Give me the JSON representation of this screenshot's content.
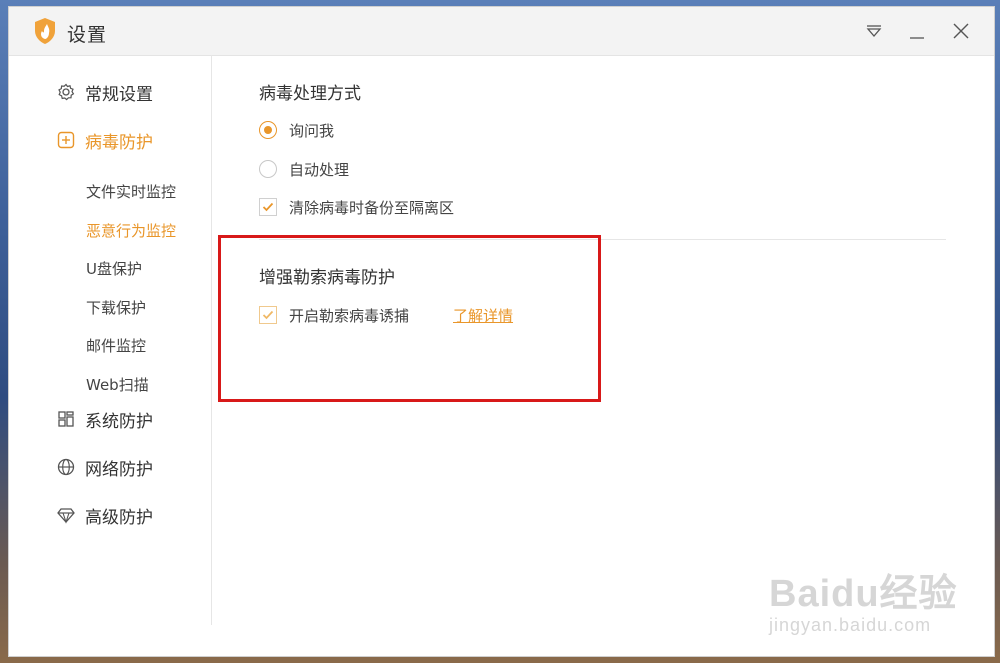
{
  "window": {
    "title": "设置",
    "logo_icon": "flame-shield-icon",
    "controls": [
      "dropdown-icon",
      "minimize-icon",
      "close-icon"
    ]
  },
  "sidebar": {
    "items": [
      {
        "label": "常规设置",
        "icon": "gear-icon",
        "active": false
      },
      {
        "label": "病毒防护",
        "icon": "plus-square-icon",
        "active": true
      },
      {
        "label": "系统防护",
        "icon": "grid-icon",
        "active": false
      },
      {
        "label": "网络防护",
        "icon": "globe-icon",
        "active": false
      },
      {
        "label": "高级防护",
        "icon": "diamond-icon",
        "active": false
      }
    ],
    "subitems": [
      {
        "label": "文件实时监控",
        "active": false
      },
      {
        "label": "恶意行为监控",
        "active": true
      },
      {
        "label": "U盘保护",
        "active": false
      },
      {
        "label": "下载保护",
        "active": false
      },
      {
        "label": "邮件监控",
        "active": false
      },
      {
        "label": "Web扫描",
        "active": false
      }
    ]
  },
  "virus_handling": {
    "title": "病毒处理方式",
    "options": [
      {
        "label": "询问我",
        "type": "radio",
        "checked": true
      },
      {
        "label": "自动处理",
        "type": "radio",
        "checked": false
      },
      {
        "label": "清除病毒时备份至隔离区",
        "type": "checkbox",
        "checked": true
      }
    ]
  },
  "ransomware": {
    "title": "增强勒索病毒防护",
    "option_label": "开启勒索病毒诱捕",
    "option_checked": true,
    "link_label": "了解详情"
  },
  "watermark": {
    "main": "Baidu经验",
    "sub": "jingyan.baidu.com"
  },
  "colors": {
    "accent": "#e9962a",
    "highlight_box": "#d81919"
  }
}
